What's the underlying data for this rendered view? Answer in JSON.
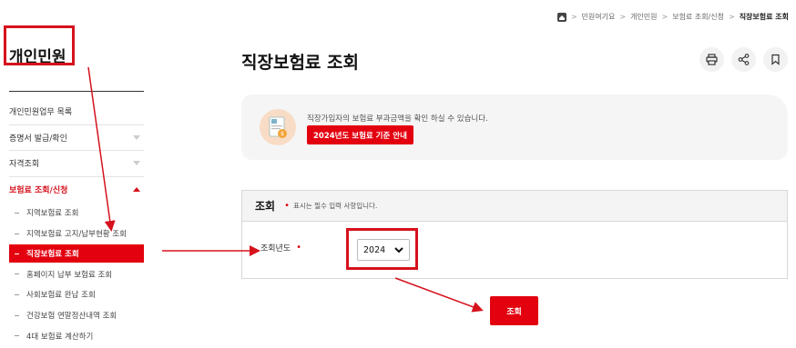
{
  "breadcrumb": {
    "items": [
      "민원여기요",
      "개인민원",
      "보험료 조회/신청",
      "직장보험료 조회"
    ]
  },
  "sidebar": {
    "title": "개인민원",
    "items": [
      {
        "label": "개인민원업무 목록",
        "has_arrow": false
      },
      {
        "label": "증명서 발급/확인",
        "has_arrow": true
      },
      {
        "label": "자격조회",
        "has_arrow": true
      },
      {
        "label": "보험료 조회/신청",
        "has_arrow": true,
        "active": true
      }
    ],
    "sub_items": [
      {
        "label": "지역보험료 조회"
      },
      {
        "label": "지역보험료 고지/납부현황 조회"
      },
      {
        "label": "직장보험료 조회",
        "active": true
      },
      {
        "label": "홈페이지 납부 보험료 조회"
      },
      {
        "label": "사회보험료 완납 조회"
      },
      {
        "label": "건강보험 연말정산내역 조회"
      },
      {
        "label": "4대 보험료 계산하기"
      }
    ]
  },
  "main": {
    "title": "직장보험료 조회",
    "tools": [
      "print-icon",
      "share-icon",
      "bookmark-icon"
    ],
    "info": {
      "text": "직장가입자의 보험료 부과금액을 확인 하실 수 있습니다.",
      "button": "2024년도 보험료 기준 안내"
    },
    "query": {
      "heading": "조회",
      "note": "표시는 필수 입력 사항입니다.",
      "year_label": "조회년도",
      "year_value": "2024",
      "submit": "조회"
    }
  },
  "colors": {
    "accent": "#e3000f",
    "annotation": "#d6121d"
  }
}
